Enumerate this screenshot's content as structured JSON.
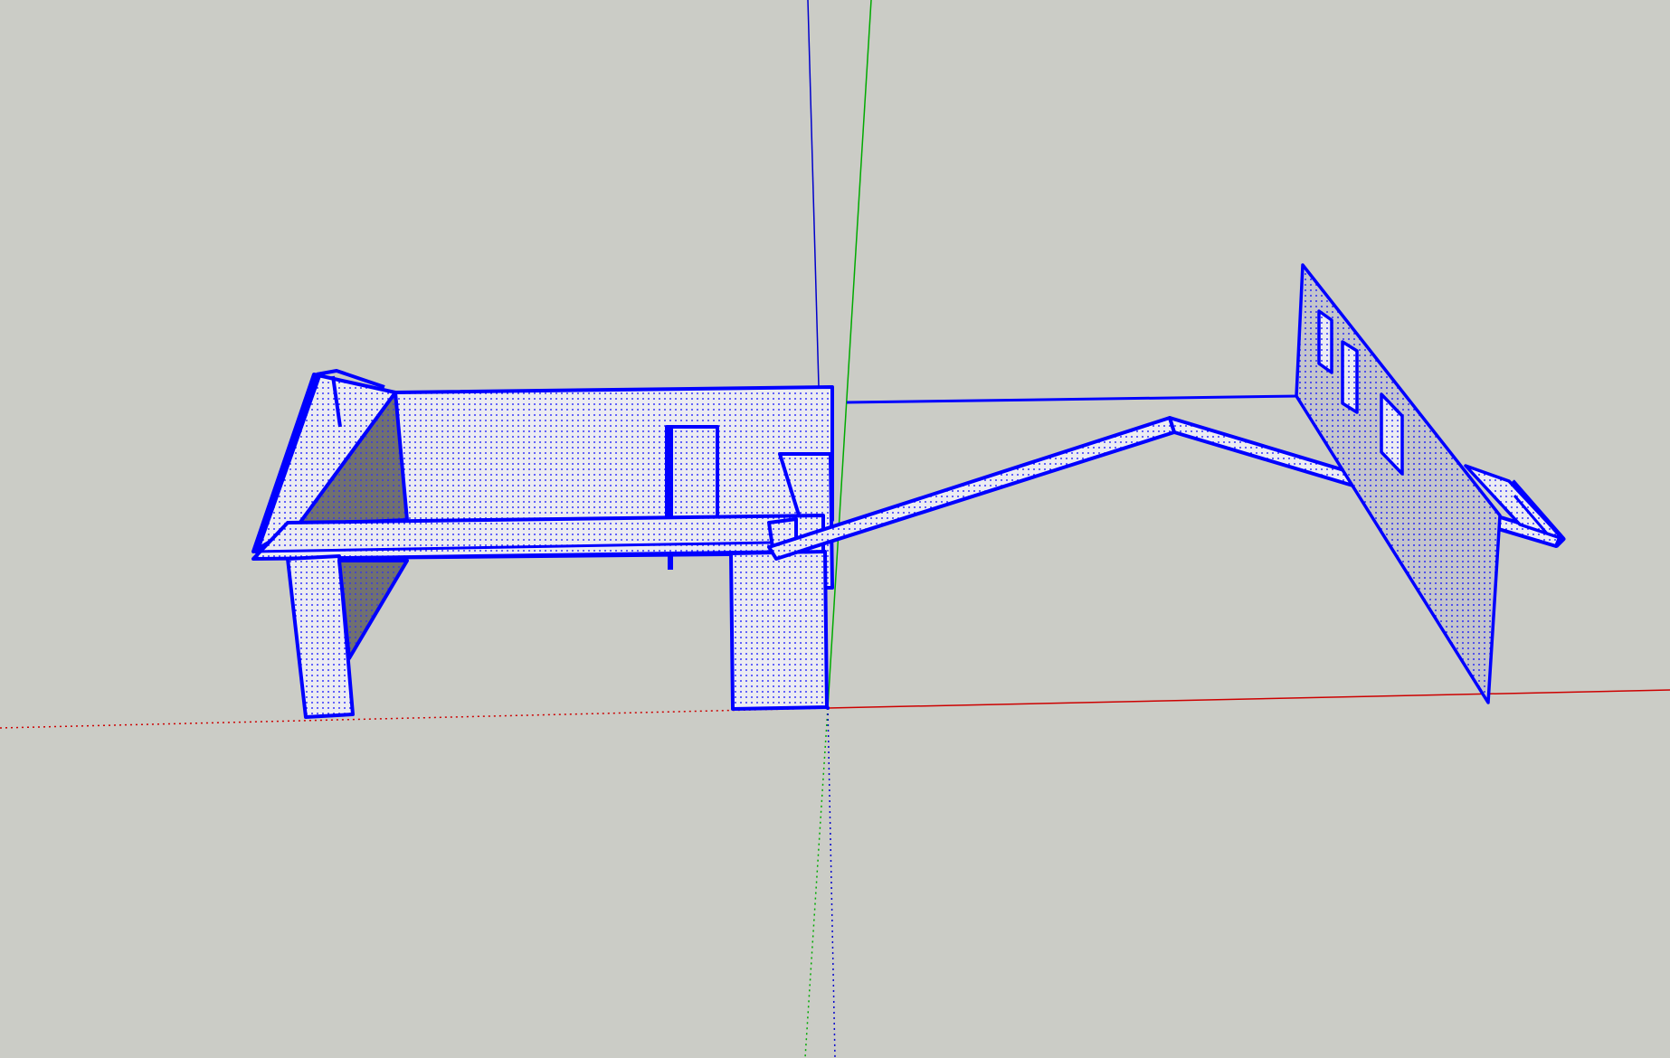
{
  "viewport": {
    "background": "#cbccc6",
    "selection_color": "#0000ff",
    "hatch_color": "#0000ff",
    "shadow_color": "#707070"
  },
  "axes": {
    "red": "#cc0000",
    "green": "#00aa00",
    "blue": "#0000cc"
  },
  "icons": [
    "axis-origin-icon"
  ]
}
